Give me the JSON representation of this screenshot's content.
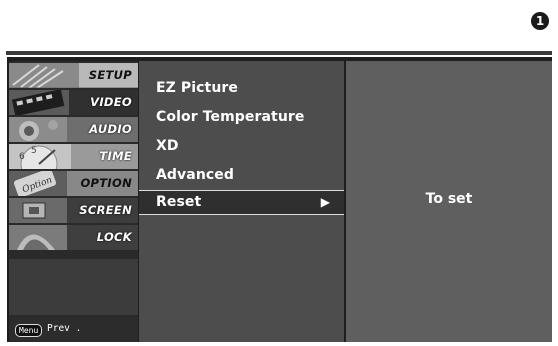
{
  "step_badge": "1",
  "sidebar": {
    "items": [
      {
        "label": "SETUP",
        "icon": "satellite-dish-icon"
      },
      {
        "label": "VIDEO",
        "icon": "film-strip-icon"
      },
      {
        "label": "AUDIO",
        "icon": "speaker-icon"
      },
      {
        "label": "TIME",
        "icon": "clock-icon"
      },
      {
        "label": "OPTION",
        "icon": "option-sign-icon"
      },
      {
        "label": "SCREEN",
        "icon": "screen-icon"
      },
      {
        "label": "LOCK",
        "icon": "lock-icon"
      }
    ],
    "active_index": 1,
    "menu_key": "Menu",
    "prev_label": "Prev ."
  },
  "submenu": {
    "items": [
      {
        "label": "EZ Picture"
      },
      {
        "label": "Color Temperature"
      },
      {
        "label": "XD"
      },
      {
        "label": "Advanced"
      },
      {
        "label": "Reset",
        "selected": true,
        "arrow": "▶"
      }
    ]
  },
  "info_panel": {
    "text": "To set"
  }
}
